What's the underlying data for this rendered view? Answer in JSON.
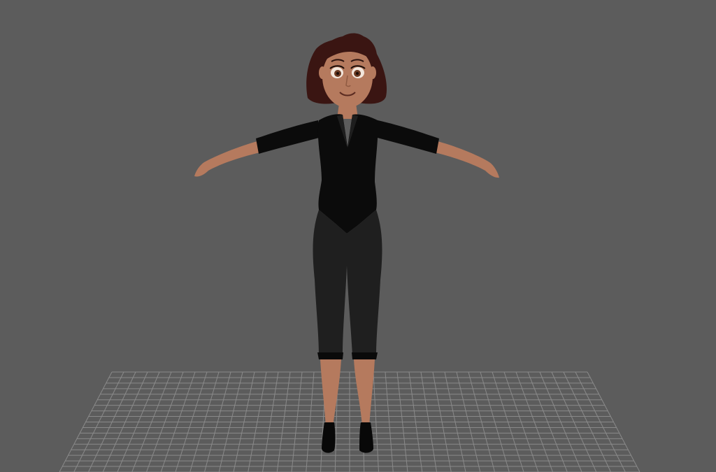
{
  "viewport": {
    "background_color": "#5c5c5c",
    "grid_color": "#8a8a8a",
    "grid_visible": true,
    "subject": "character-model-t-pose"
  },
  "character": {
    "skin_color": "#b57a5e",
    "skin_shadow": "#8f5a42",
    "hair_color": "#3a1512",
    "top_color": "#0b0b0b",
    "pants_color": "#1f1f1f",
    "shoe_color": "#080808",
    "eye_color": "#6b3a22"
  }
}
